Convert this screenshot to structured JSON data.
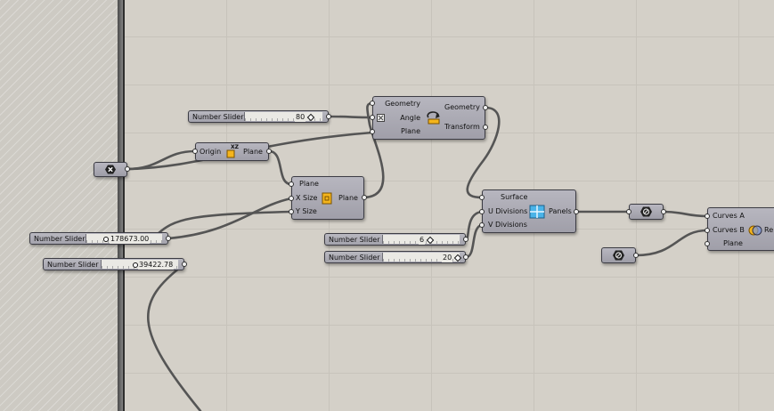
{
  "canvas": {
    "background": "#d4d0c8",
    "grid_color": "#c7c3bb",
    "wire_color": "#555555"
  },
  "sliders": [
    {
      "label": "Number Slider",
      "value": "80"
    },
    {
      "label": "Number Slider",
      "value": "178673.00"
    },
    {
      "label": "Number Slider",
      "value": "39422.78"
    },
    {
      "label": "Number Slider",
      "value": "6"
    },
    {
      "label": "Number Slider",
      "value": "20"
    }
  ],
  "components": {
    "xz_plane": {
      "icon": "xz-plane-icon",
      "inputs": [
        "Origin"
      ],
      "outputs": [
        "Plane"
      ],
      "icon_text": "XZ"
    },
    "rotate": {
      "icon": "rotate-icon",
      "inputs": [
        "Geometry",
        "Angle",
        "Plane"
      ],
      "outputs": [
        "Geometry",
        "Transform"
      ]
    },
    "rectangle": {
      "icon": "rectangle-icon",
      "inputs": [
        "Plane",
        "X Size",
        "Y Size"
      ],
      "outputs": [
        "Plane"
      ]
    },
    "panels": {
      "icon": "panels-icon",
      "inputs": [
        "Surface",
        "U Divisions",
        "V Divisions"
      ],
      "outputs": [
        "Panels"
      ]
    },
    "region": {
      "icon": "region-icon",
      "inputs": [
        "Curves A",
        "Curves B",
        "Plane"
      ],
      "outputs": [
        "Re"
      ]
    }
  },
  "relays": [
    "hexagon-x-relay",
    "wire-relay-1",
    "wire-relay-2"
  ]
}
